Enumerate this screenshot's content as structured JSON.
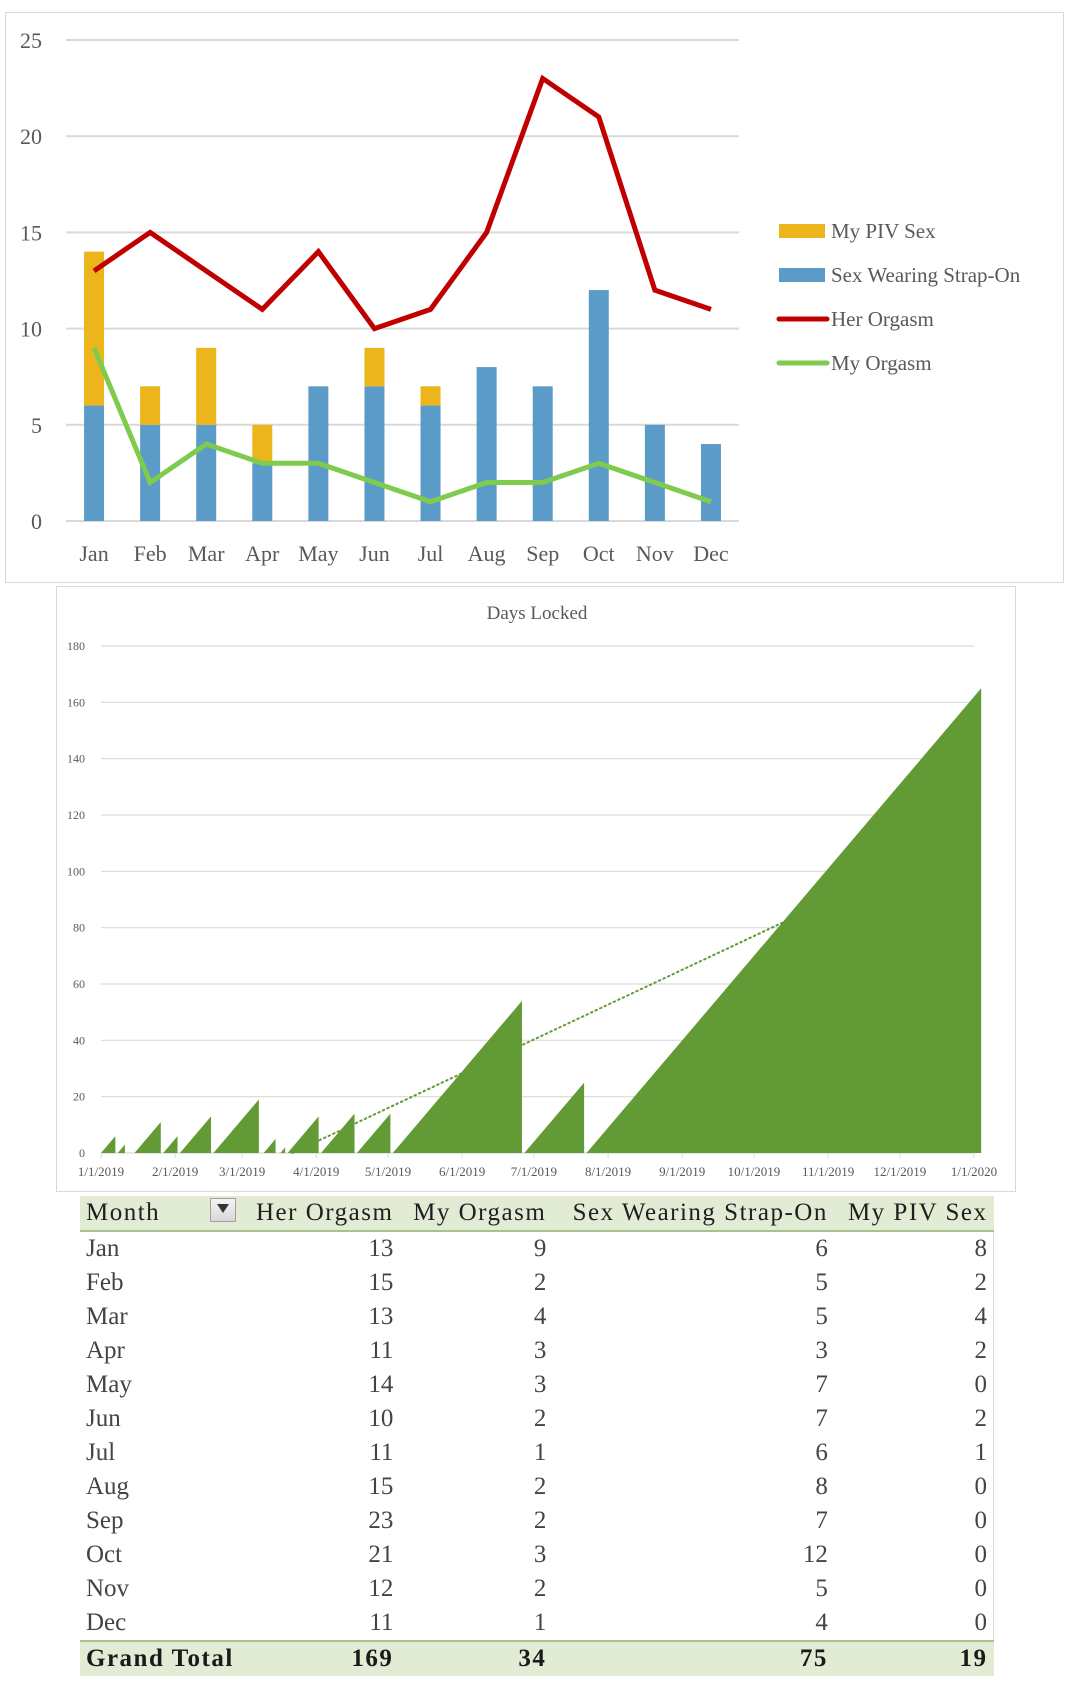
{
  "chart_data": [
    {
      "type": "bar",
      "subtype": "stacked-bar-with-lines",
      "title": "",
      "xlabel": "",
      "ylabel": "",
      "ylim": [
        0,
        25
      ],
      "yticks": [
        0,
        5,
        10,
        15,
        20,
        25
      ],
      "grid": true,
      "legend": "right",
      "categories": [
        "Jan",
        "Feb",
        "Mar",
        "Apr",
        "May",
        "Jun",
        "Jul",
        "Aug",
        "Sep",
        "Oct",
        "Nov",
        "Dec"
      ],
      "series": [
        {
          "name": "Sex Wearing Strap-On",
          "kind": "bar",
          "stack": 0,
          "color": "#5b9bc8",
          "values": [
            6,
            5,
            5,
            3,
            7,
            7,
            6,
            8,
            7,
            12,
            5,
            4
          ]
        },
        {
          "name": "My PIV Sex",
          "kind": "bar",
          "stack": 1,
          "color": "#ecb51b",
          "values": [
            8,
            2,
            4,
            2,
            0,
            2,
            1,
            0,
            0,
            0,
            0,
            0
          ]
        },
        {
          "name": "Her Orgasm",
          "kind": "line",
          "color": "#c00000",
          "values": [
            13,
            15,
            13,
            11,
            14,
            10,
            11,
            15,
            23,
            21,
            12,
            11
          ]
        },
        {
          "name": "My Orgasm",
          "kind": "line",
          "color": "#7ecb4e",
          "values": [
            9,
            2,
            4,
            3,
            3,
            2,
            1,
            2,
            2,
            3,
            2,
            1
          ]
        }
      ],
      "legend_order": [
        "My PIV Sex",
        "Sex Wearing Strap-On",
        "Her Orgasm",
        "My Orgasm"
      ]
    },
    {
      "type": "area",
      "title": "Days Locked",
      "xlabel": "",
      "ylabel": "",
      "ylim": [
        0,
        180
      ],
      "yticks": [
        0,
        20,
        40,
        60,
        80,
        100,
        120,
        140,
        160,
        180
      ],
      "xlim": [
        "1/1/2019",
        "1/1/2020"
      ],
      "xticks": [
        "1/1/2019",
        "2/1/2019",
        "3/1/2019",
        "4/1/2019",
        "5/1/2019",
        "6/1/2019",
        "7/1/2019",
        "8/1/2019",
        "9/1/2019",
        "10/1/2019",
        "11/1/2019",
        "12/1/2019",
        "1/1/2020"
      ],
      "grid": true,
      "color": "#629b35",
      "unit_x": "day-of-year",
      "lock_periods": [
        {
          "start_day": 0,
          "days": 6
        },
        {
          "start_day": 7,
          "days": 3
        },
        {
          "start_day": 14,
          "days": 11
        },
        {
          "start_day": 26,
          "days": 6
        },
        {
          "start_day": 33,
          "days": 13
        },
        {
          "start_day": 47,
          "days": 19
        },
        {
          "start_day": 68,
          "days": 5
        },
        {
          "start_day": 75,
          "days": 2
        },
        {
          "start_day": 78,
          "days": 13
        },
        {
          "start_day": 92,
          "days": 14
        },
        {
          "start_day": 107,
          "days": 14
        },
        {
          "start_day": 122,
          "days": 54
        },
        {
          "start_day": 177,
          "days": 25
        },
        {
          "start_day": 203,
          "days": 165
        }
      ],
      "trendline": {
        "style": "dotted",
        "color": "#629b35",
        "from": {
          "day": 80,
          "value": 0
        },
        "to": {
          "day": 293,
          "value": 85
        }
      }
    }
  ],
  "table": {
    "columns": [
      "Month",
      "Her Orgasm",
      "My Orgasm",
      "Sex Wearing Strap-On",
      "My PIV Sex"
    ],
    "rows": [
      {
        "month": "Jan",
        "her": "13",
        "my": "9",
        "strapon": "6",
        "piv": "8"
      },
      {
        "month": "Feb",
        "her": "15",
        "my": "2",
        "strapon": "5",
        "piv": "2"
      },
      {
        "month": "Mar",
        "her": "13",
        "my": "4",
        "strapon": "5",
        "piv": "4"
      },
      {
        "month": "Apr",
        "her": "11",
        "my": "3",
        "strapon": "3",
        "piv": "2"
      },
      {
        "month": "May",
        "her": "14",
        "my": "3",
        "strapon": "7",
        "piv": "0"
      },
      {
        "month": "Jun",
        "her": "10",
        "my": "2",
        "strapon": "7",
        "piv": "2"
      },
      {
        "month": "Jul",
        "her": "11",
        "my": "1",
        "strapon": "6",
        "piv": "1"
      },
      {
        "month": "Aug",
        "her": "15",
        "my": "2",
        "strapon": "8",
        "piv": "0"
      },
      {
        "month": "Sep",
        "her": "23",
        "my": "2",
        "strapon": "7",
        "piv": "0"
      },
      {
        "month": "Oct",
        "her": "21",
        "my": "3",
        "strapon": "12",
        "piv": "0"
      },
      {
        "month": "Nov",
        "her": "12",
        "my": "2",
        "strapon": "5",
        "piv": "0"
      },
      {
        "month": "Dec",
        "her": "11",
        "my": "1",
        "strapon": "4",
        "piv": "0"
      }
    ],
    "total": {
      "month": "Grand Total",
      "her": "169",
      "my": "34",
      "strapon": "75",
      "piv": "19"
    },
    "filter_icon": "filter-dropdown-icon"
  }
}
